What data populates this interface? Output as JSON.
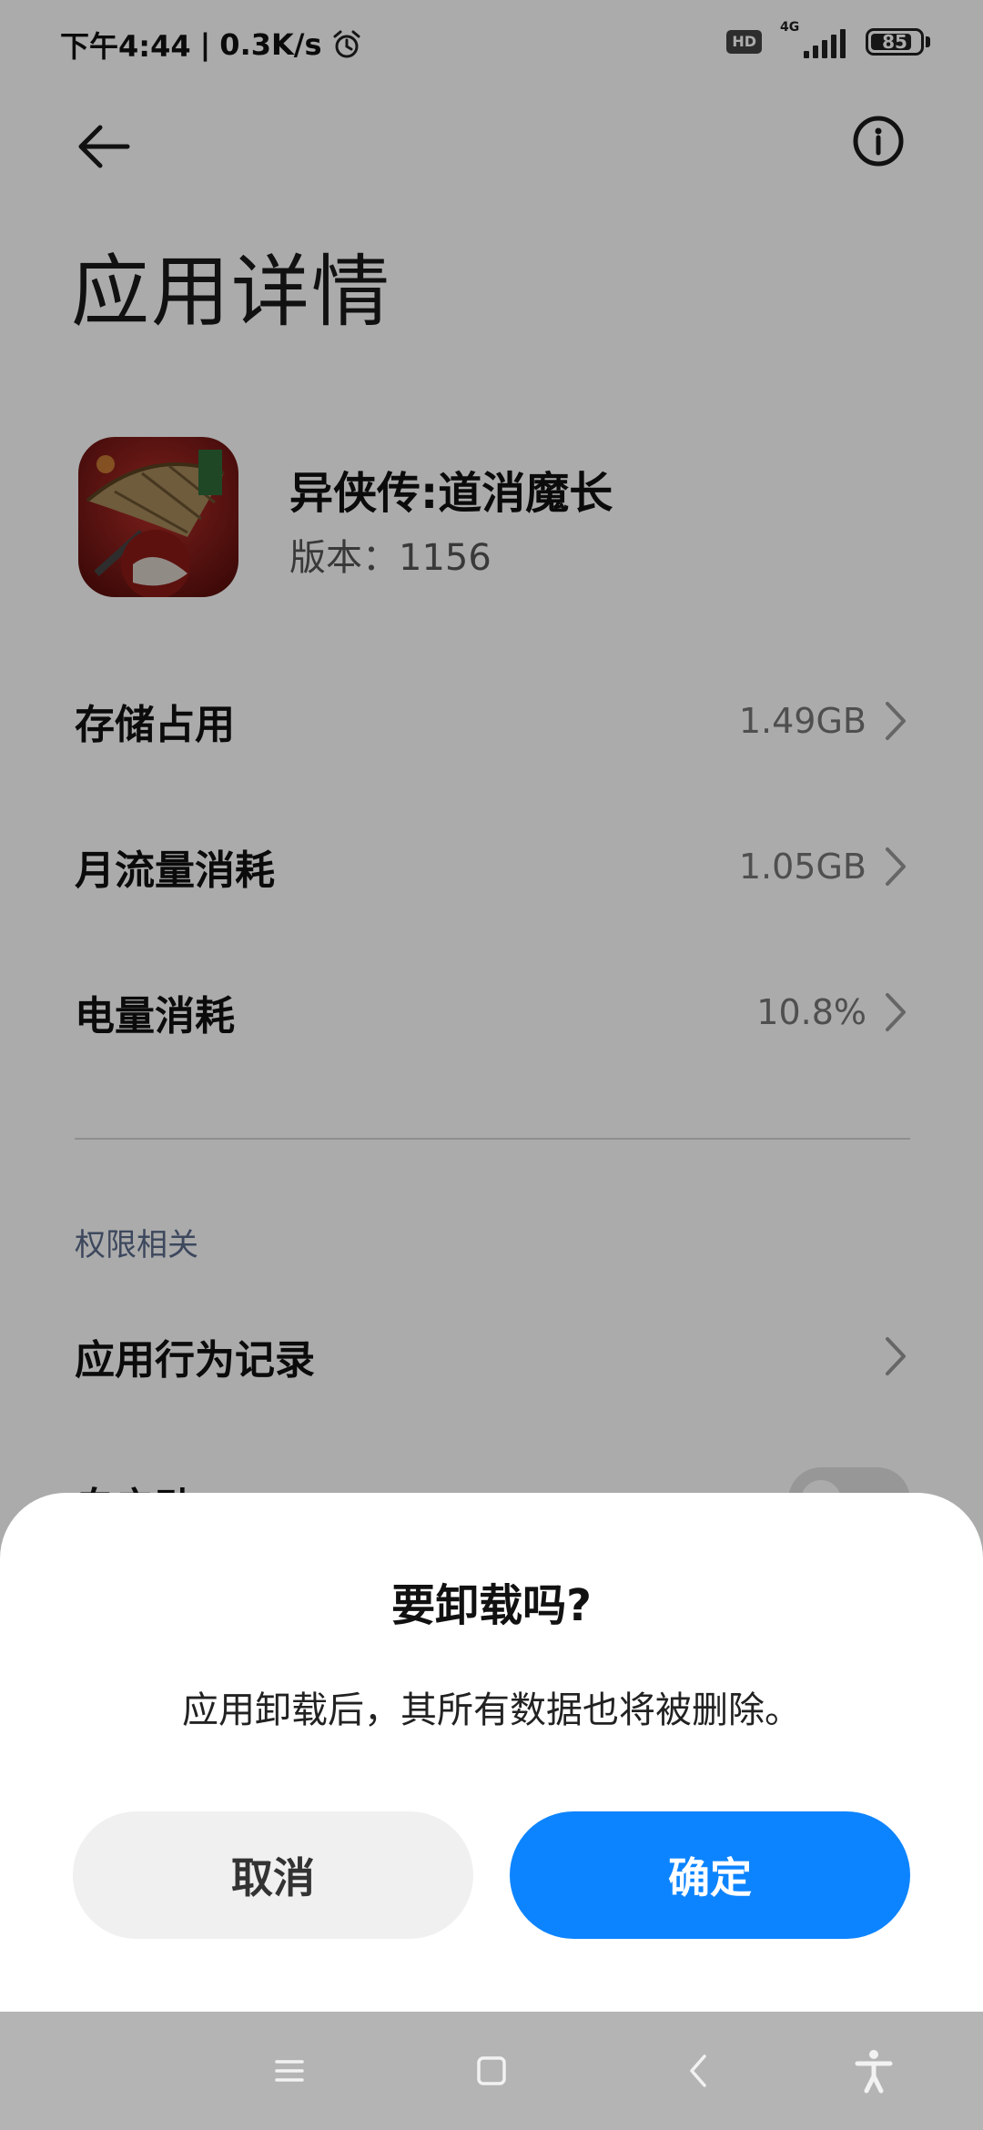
{
  "status_bar": {
    "time": "下午4:44",
    "separator": "|",
    "net_speed": "0.3K/s",
    "hd_label": "HD",
    "network_type": "4G",
    "battery": "85",
    "battery_level_percent": 85
  },
  "header": {
    "title": "应用详情"
  },
  "app": {
    "name": "异侠传:道消魔长",
    "version": "版本：1156"
  },
  "rows": [
    {
      "label": "存储占用",
      "value": "1.49GB"
    },
    {
      "label": "月流量消耗",
      "value": "1.05GB"
    },
    {
      "label": "电量消耗",
      "value": "10.8%"
    }
  ],
  "permissions": {
    "section_title": "权限相关",
    "behavior_record_label": "应用行为记录",
    "autostart_label": "自启动",
    "autostart_enabled": false
  },
  "dialog": {
    "title": "要卸载吗?",
    "message": "应用卸载后，其所有数据也将被删除。",
    "cancel_label": "取消",
    "confirm_label": "确定"
  },
  "colors": {
    "accent": "#0d84ff",
    "section_title": "#5c6c8c"
  }
}
